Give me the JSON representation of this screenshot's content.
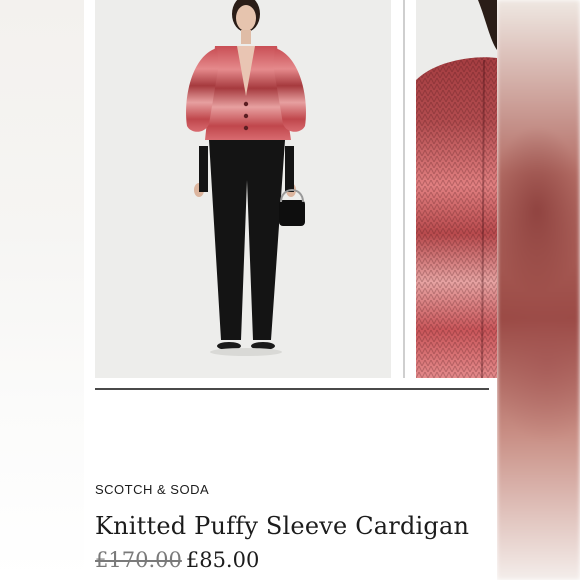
{
  "product": {
    "brand": "SCOTCH & SODA",
    "title": "Knitted Puffy Sleeve Cardigan",
    "original_price": "£170.00",
    "sale_price": "£85.00"
  },
  "gallery": {
    "images": [
      {
        "name": "product-photo-model-full",
        "alt": "Model wearing cardigan"
      },
      {
        "name": "product-photo-knit-detail",
        "alt": "Knit detail"
      }
    ]
  },
  "colors": {
    "cardigan_pink": "#d86b70",
    "cardigan_red": "#a83a3d",
    "trousers": "#141414",
    "photo_bg": "#ededeb"
  }
}
